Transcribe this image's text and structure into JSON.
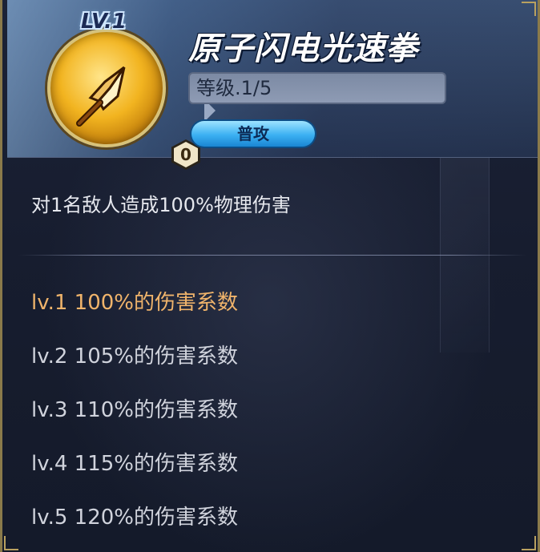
{
  "skill": {
    "level_badge": "LV.1",
    "name": "原子闪电光速拳",
    "level_text": "等级.1/5",
    "type_label": "普攻",
    "count": "0",
    "icon": "arrowhead-icon"
  },
  "description": "对1名敌人造成100%物理伤害",
  "levels": [
    {
      "label": "lv.1 100%的伤害系数",
      "current": true
    },
    {
      "label": "lv.2 105%的伤害系数",
      "current": false
    },
    {
      "label": "lv.3 110%的伤害系数",
      "current": false
    },
    {
      "label": "lv.4 115%的伤害系数",
      "current": false
    },
    {
      "label": "lv.5 120%的伤害系数",
      "current": false
    }
  ],
  "colors": {
    "current_level": "#f0b46b",
    "text": "#d0d3dc",
    "pill": "#3bb0f2",
    "icon_gold": "#f2b420"
  }
}
